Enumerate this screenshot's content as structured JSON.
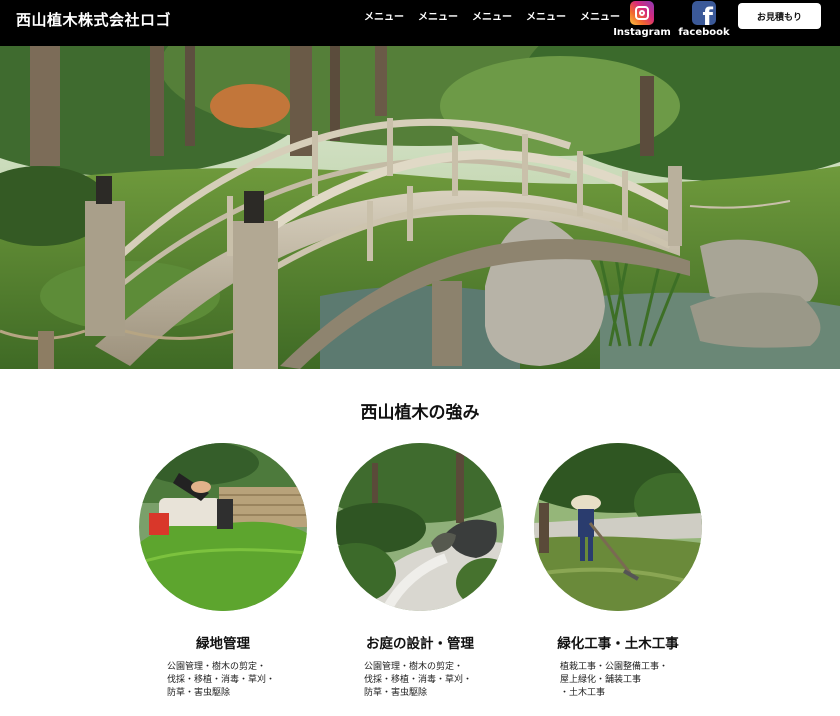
{
  "header": {
    "logo": "西山植木株式会社ロゴ",
    "nav": [
      "メニュー",
      "メニュー",
      "メニュー",
      "メニュー",
      "メニュー"
    ],
    "social": [
      {
        "label": "Instagram",
        "icon": "instagram-icon"
      },
      {
        "label": "facebook",
        "icon": "facebook-icon"
      }
    ],
    "quote_button": "お見積もり"
  },
  "hero": {
    "image": "japanese-garden-arched-bridge"
  },
  "strengths": {
    "title": "西山植木の強み",
    "cards": [
      {
        "title": "緑地管理",
        "image": "hedge-trimming",
        "lines": [
          "公園管理・樹木の剪定・",
          "伐採・移植・消毒・草刈・",
          "防草・害虫駆除"
        ]
      },
      {
        "title": "お庭の設計・管理",
        "image": "japanese-garden-path",
        "lines": [
          "公園管理・樹木の剪定・",
          "伐採・移植・消毒・草刈・",
          "防草・害虫駆除"
        ]
      },
      {
        "title": "緑化工事・土木工事",
        "image": "gardener-raking",
        "lines": [
          "植栽工事・公園整備工事・",
          "屋上緑化・舗装工事",
          "・土木工事"
        ]
      }
    ]
  },
  "colors": {
    "header_bg": "#000000",
    "page_bg": "#ffffff",
    "text": "#111111"
  }
}
